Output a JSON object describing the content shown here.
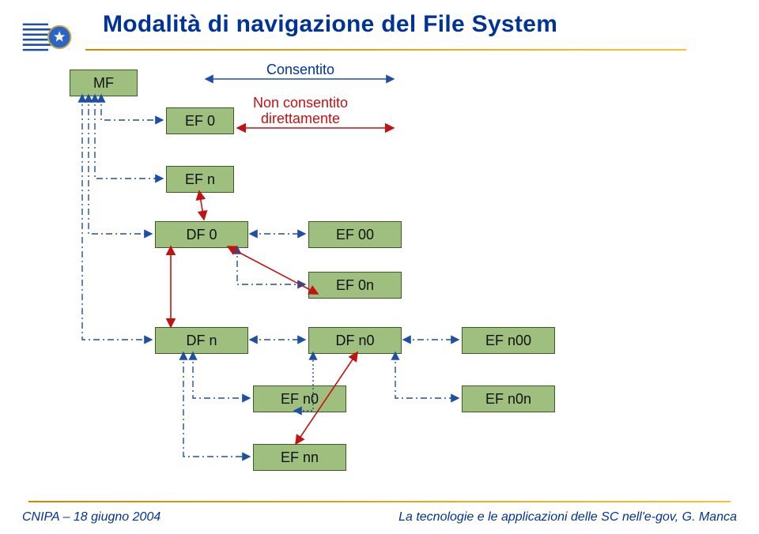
{
  "title": "Modalità di navigazione del File System",
  "legend": {
    "allowed": "Consentito",
    "denied": "Non consentito direttamente"
  },
  "nodes": {
    "mf": "MF",
    "ef0": "EF 0",
    "efn": "EF n",
    "df0": "DF 0",
    "ef00": "EF 00",
    "ef0n": "EF 0n",
    "dfn": "DF n",
    "dfn0": "DF n0",
    "efn00": "EF n00",
    "efn0": "EF n0",
    "efn0n": "EF n0n",
    "efnn": "EF nn"
  },
  "footer": {
    "left": "CNIPA – 18 giugno 2004",
    "right": "La tecnologie e le applicazioni delle SC nell'e-gov, G. Manca"
  },
  "chart_data": {
    "type": "diagram",
    "title": "Modalità di navigazione del File System",
    "nodes": [
      {
        "id": "MF",
        "kind": "MF"
      },
      {
        "id": "EF0",
        "kind": "EF",
        "parent": "MF"
      },
      {
        "id": "EFn",
        "kind": "EF",
        "parent": "MF"
      },
      {
        "id": "DF0",
        "kind": "DF",
        "parent": "MF"
      },
      {
        "id": "EF00",
        "kind": "EF",
        "parent": "DF0"
      },
      {
        "id": "EF0n",
        "kind": "EF",
        "parent": "DF0"
      },
      {
        "id": "DFn",
        "kind": "DF",
        "parent": "MF"
      },
      {
        "id": "DFn0",
        "kind": "DF",
        "parent": "DFn"
      },
      {
        "id": "EFn00",
        "kind": "EF",
        "parent": "DFn0"
      },
      {
        "id": "EFn0",
        "kind": "EF",
        "parent": "DFn0"
      },
      {
        "id": "EFn0n",
        "kind": "EF",
        "parent": "DFn0"
      },
      {
        "id": "EFnn",
        "kind": "EF",
        "parent": "DFn"
      }
    ],
    "edges_allowed_bidirectional": [
      [
        "MF",
        "EF0"
      ],
      [
        "MF",
        "EFn"
      ],
      [
        "MF",
        "DF0"
      ],
      [
        "MF",
        "DFn"
      ],
      [
        "DF0",
        "EF00"
      ],
      [
        "DF0",
        "EF0n"
      ],
      [
        "DFn",
        "DFn0"
      ],
      [
        "DFn",
        "EFnn"
      ],
      [
        "DFn",
        "EFn0"
      ],
      [
        "DFn0",
        "EFn00"
      ],
      [
        "DFn0",
        "EFn0n"
      ],
      [
        "DFn0",
        "EFn0"
      ]
    ],
    "edges_not_allowed_directly": [
      [
        "DF0",
        "DFn"
      ],
      [
        "EFnn",
        "DFn0"
      ],
      [
        "DF0",
        "EFn"
      ]
    ],
    "legend": {
      "dash_blue": "Consentito",
      "solid_red": "Non consentito direttamente"
    }
  }
}
